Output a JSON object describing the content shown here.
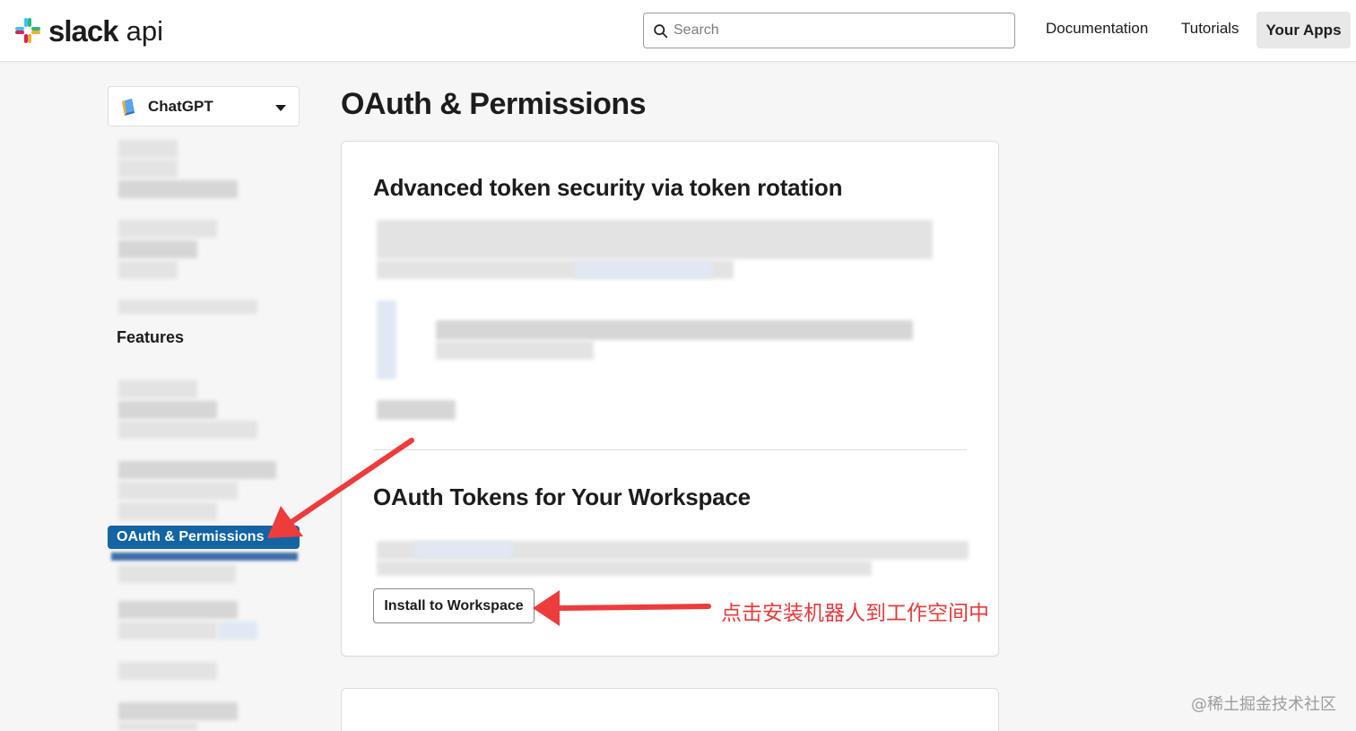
{
  "header": {
    "logo_text": "slack",
    "logo_suffix": "api",
    "search_placeholder": "Search",
    "nav": {
      "documentation": "Documentation",
      "tutorials": "Tutorials",
      "your_apps": "Your Apps"
    }
  },
  "sidebar": {
    "app_name": "ChatGPT",
    "features_label": "Features",
    "active_item": "OAuth & Permissions"
  },
  "main": {
    "page_title": "OAuth & Permissions",
    "section1_title": "Advanced token security via token rotation",
    "section2_title": "OAuth Tokens for Your Workspace",
    "install_button": "Install to Workspace"
  },
  "annotation": {
    "text": "点击安装机器人到工作空间中",
    "color": "#e8393b"
  },
  "watermark": "@稀土掘金技术社区",
  "colors": {
    "accent": "#1264a3",
    "annotation_red": "#e8393b"
  },
  "icons": {
    "logo": "slack-logo-icon",
    "search": "search-icon",
    "app": "app-icon",
    "dropdown": "chevron-down-icon"
  }
}
